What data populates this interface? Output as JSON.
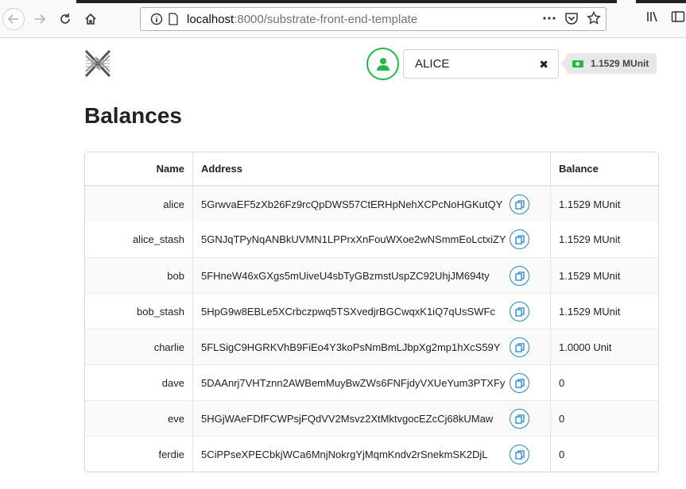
{
  "browser": {
    "url_host": "localhost",
    "url_rest": ":8000/substrate-front-end-template",
    "icons": [
      "back-arrow-icon",
      "forward-arrow-icon",
      "reload-icon",
      "home-icon",
      "info-icon",
      "page-icon",
      "more-icon",
      "pocket-icon",
      "star-icon",
      "library-icon",
      "sidebar-icon"
    ]
  },
  "header": {
    "account_name": "ALICE",
    "clear_symbol": "✖",
    "balance": "1.1529 MUnit",
    "accent_green": "#21ba45",
    "accent_blue": "#2185d0"
  },
  "page": {
    "title": "Balances"
  },
  "table": {
    "headers": [
      "Name",
      "Address",
      "Balance"
    ],
    "rows": [
      {
        "name": "alice",
        "address": "5GrwvaEF5zXb26Fz9rcQpDWS57CtERHpNehXCPcNoHGKutQY",
        "balance": "1.1529 MUnit"
      },
      {
        "name": "alice_stash",
        "address": "5GNJqTPyNqANBkUVMN1LPPrxXnFouWXoe2wNSmmEoLctxiZY",
        "balance": "1.1529 MUnit"
      },
      {
        "name": "bob",
        "address": "5FHneW46xGXgs5mUiveU4sbTyGBzmstUspZC92UhjJM694ty",
        "balance": "1.1529 MUnit"
      },
      {
        "name": "bob_stash",
        "address": "5HpG9w8EBLe5XCrbczpwq5TSXvedjrBGCwqxK1iQ7qUsSWFc",
        "balance": "1.1529 MUnit"
      },
      {
        "name": "charlie",
        "address": "5FLSigC9HGRKVhB9FiEo4Y3koPsNmBmLJbpXg2mp1hXcS59Y",
        "balance": "1.0000 Unit"
      },
      {
        "name": "dave",
        "address": "5DAAnrj7VHTznn2AWBemMuyBwZWs6FNFjdyVXUeYum3PTXFy",
        "balance": "0"
      },
      {
        "name": "eve",
        "address": "5HGjWAeFDfFCWPsjFQdVV2Msvz2XtMktvgocEZcCj68kUMaw",
        "balance": "0"
      },
      {
        "name": "ferdie",
        "address": "5CiPPseXPECbkjWCa6MnjNokrgYjMqmKndv2rSnekmSK2DjL",
        "balance": "0"
      }
    ]
  }
}
